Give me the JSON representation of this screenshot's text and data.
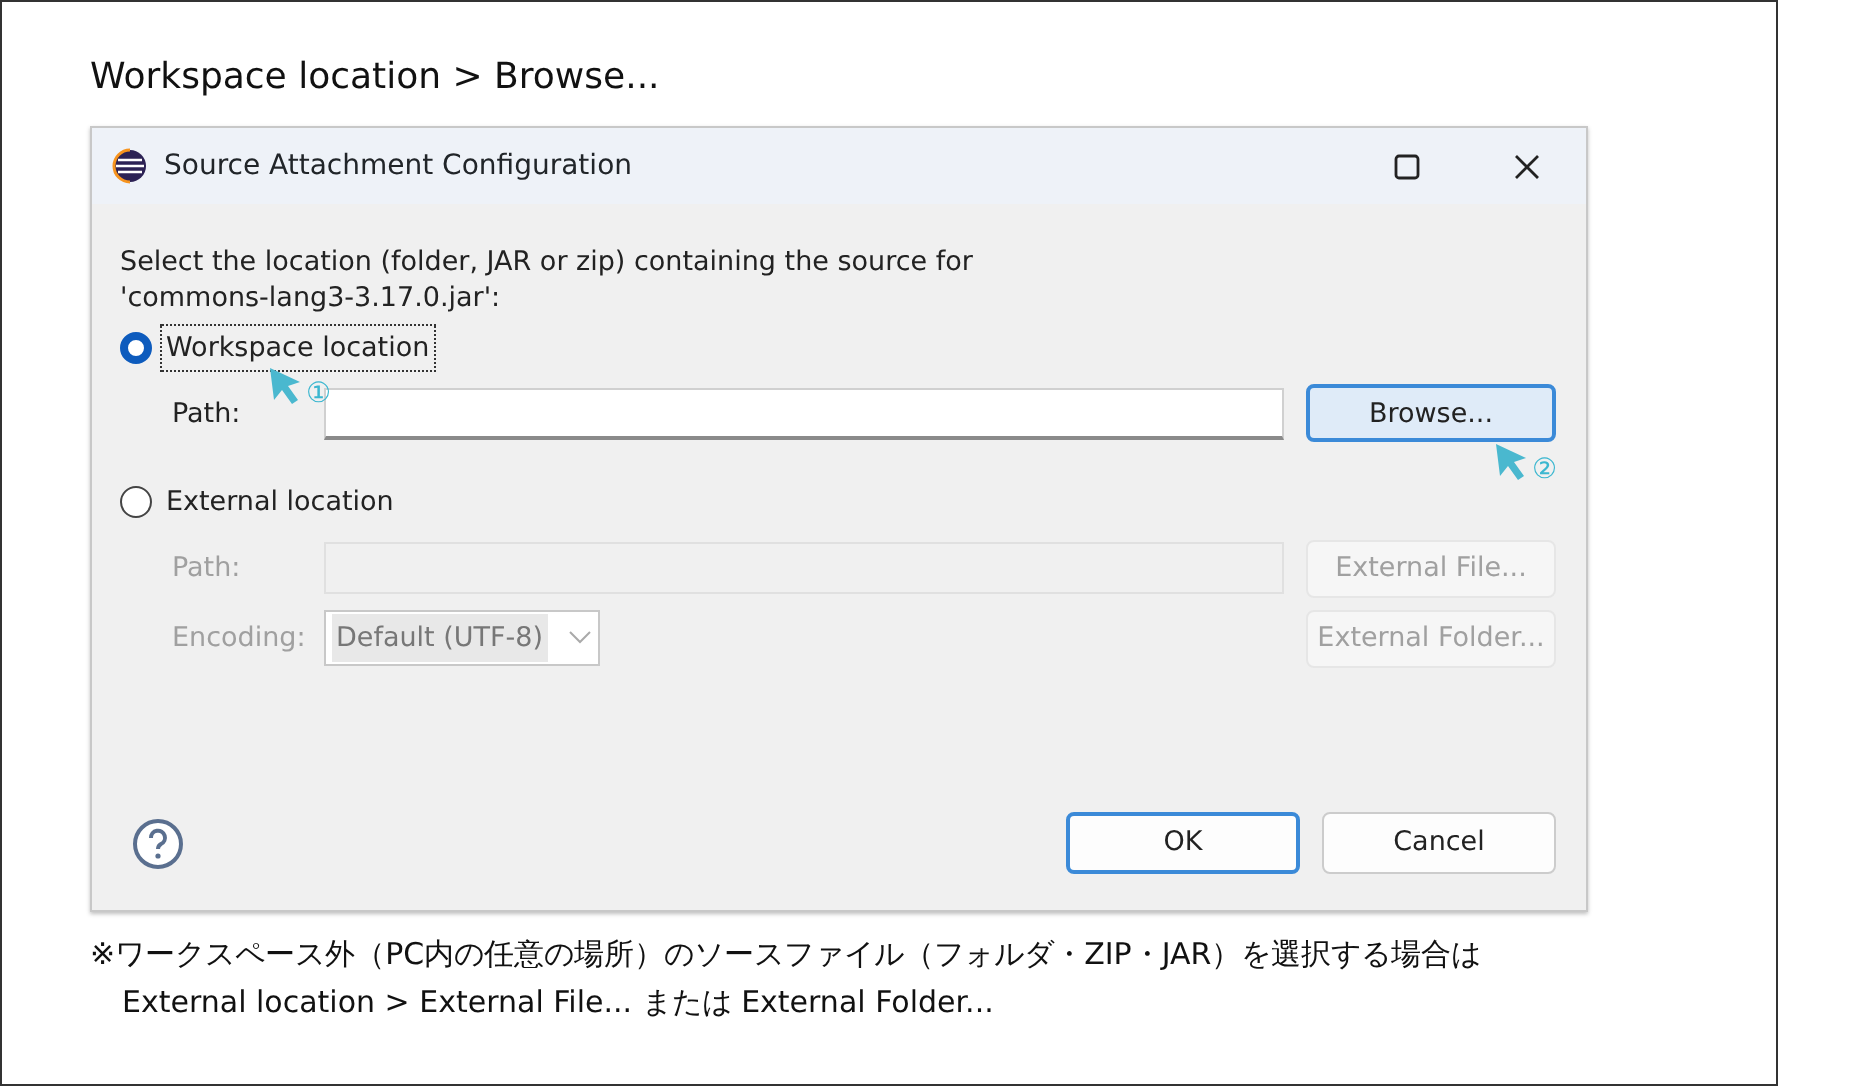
{
  "heading": "Workspace location > Browse...",
  "dialog": {
    "title": "Source Attachment Configuration",
    "description": "Select the location (folder, JAR or zip) containing the source for 'commons-lang3-3.17.0.jar':",
    "options": [
      {
        "label": "Workspace location",
        "selected": true,
        "focused": true,
        "rows": [
          {
            "kind": "path",
            "label": "Path:",
            "disabled": false,
            "button": "Browse...",
            "button_focused": true
          }
        ]
      },
      {
        "label": "External location",
        "selected": false,
        "focused": false,
        "rows": [
          {
            "kind": "path",
            "label": "Path:",
            "disabled": true,
            "button": "External File..."
          },
          {
            "kind": "select",
            "label": "Encoding:",
            "disabled": true,
            "value": "Default (UTF-8)",
            "button": "External Folder..."
          }
        ]
      }
    ],
    "buttons": [
      {
        "label": "OK",
        "default": true
      },
      {
        "label": "Cancel",
        "default": false
      }
    ]
  },
  "annotations": [
    "①",
    "②"
  ],
  "note": [
    "※ワークスペース外（PC内の任意の場所）のソースファイル（フォルダ・ZIP・JAR）を選択する場合は",
    "External location > External File... または External Folder..."
  ]
}
